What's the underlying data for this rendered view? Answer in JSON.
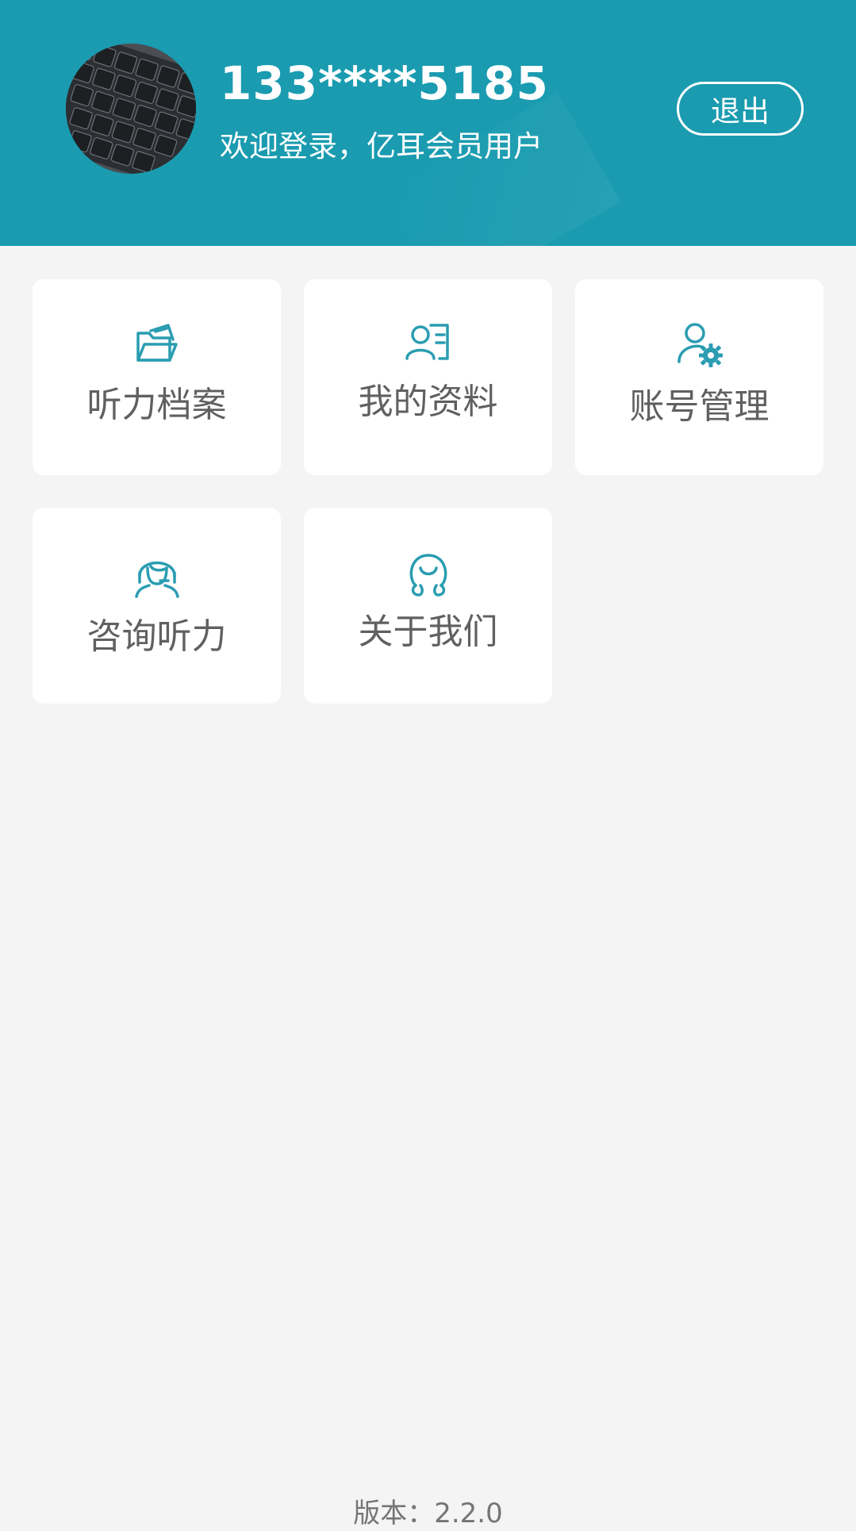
{
  "header": {
    "phone": "133****5185",
    "welcome": "欢迎登录，亿耳会员用户",
    "logout_label": "退出",
    "background_color": "#1a9bb0"
  },
  "menu": {
    "items": [
      {
        "label": "听力档案",
        "icon": "folder-icon"
      },
      {
        "label": "我的资料",
        "icon": "profile-card-icon"
      },
      {
        "label": "账号管理",
        "icon": "user-settings-icon"
      },
      {
        "label": "咨询听力",
        "icon": "headset-agent-icon"
      },
      {
        "label": "关于我们",
        "icon": "smile-face-icon"
      }
    ],
    "icon_color": "#2a9db1"
  },
  "footer": {
    "version": "版本：2.2.0"
  }
}
